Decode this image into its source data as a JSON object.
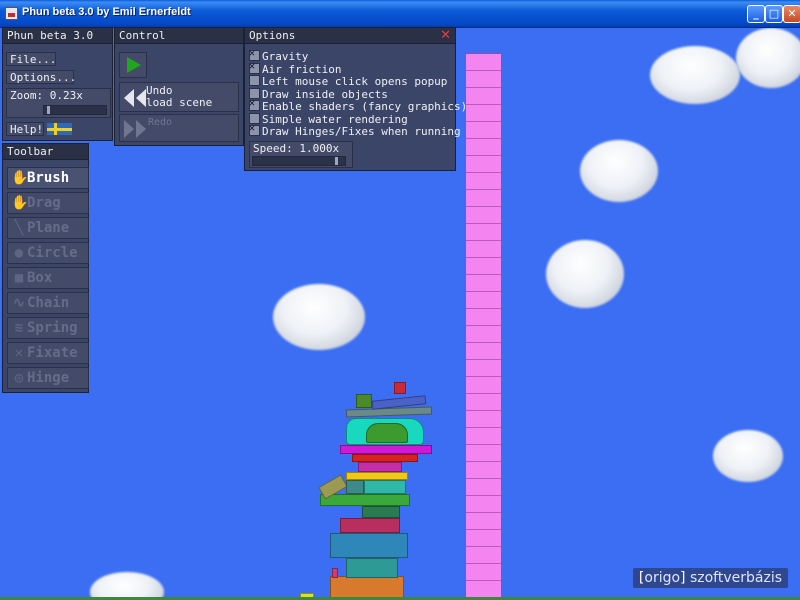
{
  "window": {
    "title": "Phun beta 3.0 by Emil Ernerfeldt",
    "buttons": {
      "minimize": "_",
      "maximize": "□",
      "close": "✕"
    }
  },
  "phun_panel": {
    "heading": "Phun beta 3.0",
    "file_label": "File...",
    "options_label": "Options...",
    "zoom_label": "Zoom: 0.23x",
    "zoom_level": 0.23,
    "help_label": "Help!",
    "flag_icon": "swedish-flag-icon"
  },
  "control_panel": {
    "heading": "Control",
    "play_icon": "play-icon",
    "undo_label_line1": "Undo",
    "undo_label_line2": "load scene",
    "redo_label": "Redo"
  },
  "options_panel": {
    "heading": "Options",
    "close_icon": "close-icon",
    "items": [
      {
        "label": "Gravity",
        "checked": true
      },
      {
        "label": "Air friction",
        "checked": true
      },
      {
        "label": "Left mouse click opens popup",
        "checked": false
      },
      {
        "label": "Draw inside objects",
        "checked": false
      },
      {
        "label": "Enable shaders (fancy graphics)",
        "checked": true
      },
      {
        "label": "Simple water rendering",
        "checked": false
      },
      {
        "label": "Draw Hinges/Fixes when running",
        "checked": true
      }
    ],
    "speed_label": "Speed: 1.000x",
    "speed_value": 1.0
  },
  "toolbar": {
    "heading": "Toolbar",
    "tools": [
      {
        "label": "Brush",
        "icon": "brush-icon",
        "active": true
      },
      {
        "label": "Drag",
        "icon": "drag-hand-icon",
        "active": false
      },
      {
        "label": "Plane",
        "icon": "plane-icon",
        "active": false
      },
      {
        "label": "Circle",
        "icon": "circle-icon",
        "active": false
      },
      {
        "label": "Box",
        "icon": "box-icon",
        "active": false
      },
      {
        "label": "Chain",
        "icon": "chain-icon",
        "active": false
      },
      {
        "label": "Spring",
        "icon": "spring-icon",
        "active": false
      },
      {
        "label": "Fixate",
        "icon": "fixate-icon",
        "active": false
      },
      {
        "label": "Hinge",
        "icon": "hinge-icon",
        "active": false
      }
    ]
  },
  "watermark": {
    "bracket_open": "[",
    "brand": "origo",
    "bracket_close": "]",
    "text": " szoftverbázis"
  },
  "colors": {
    "sky": "#3b6ef2",
    "panel": "#3a425c",
    "pink_column": "#f384f0"
  }
}
